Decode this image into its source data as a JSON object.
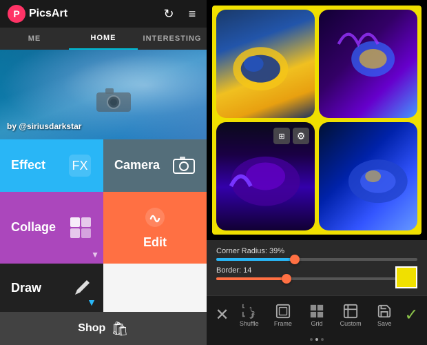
{
  "app": {
    "name": "PicsArt",
    "logo_text": "PicsArt"
  },
  "nav": {
    "tabs": [
      {
        "label": "ME",
        "active": false
      },
      {
        "label": "HOME",
        "active": true
      },
      {
        "label": "INTERESTING",
        "active": false
      }
    ]
  },
  "hero": {
    "attribution": "by @siriusdarkstar"
  },
  "menu": {
    "items": [
      {
        "label": "Effect",
        "icon": "🎨",
        "bg": "effect"
      },
      {
        "label": "Camera",
        "icon": "📷",
        "bg": "camera"
      },
      {
        "label": "Collage",
        "icon": "🖼",
        "bg": "collage"
      },
      {
        "label": "Edit",
        "icon": "✏️",
        "bg": "edit"
      },
      {
        "label": "Draw",
        "icon": "✏️",
        "bg": "draw"
      }
    ],
    "shop_label": "Shop",
    "shop_icon": "🛍"
  },
  "collage": {
    "corner_radius_label": "Corner Radius: 39%",
    "border_label": "Border: 14",
    "corner_radius_pct": 39,
    "border_val": 14,
    "color_swatch": "#f0e000"
  },
  "bottom_toolbar": {
    "items": [
      {
        "label": "Shuffle",
        "icon": "shuffle"
      },
      {
        "label": "Frame",
        "icon": "frame"
      },
      {
        "label": "Grid",
        "icon": "grid"
      },
      {
        "label": "Custom",
        "icon": "custom"
      },
      {
        "label": "Save",
        "icon": "save"
      }
    ],
    "cancel_label": "✕",
    "confirm_label": "✓"
  }
}
